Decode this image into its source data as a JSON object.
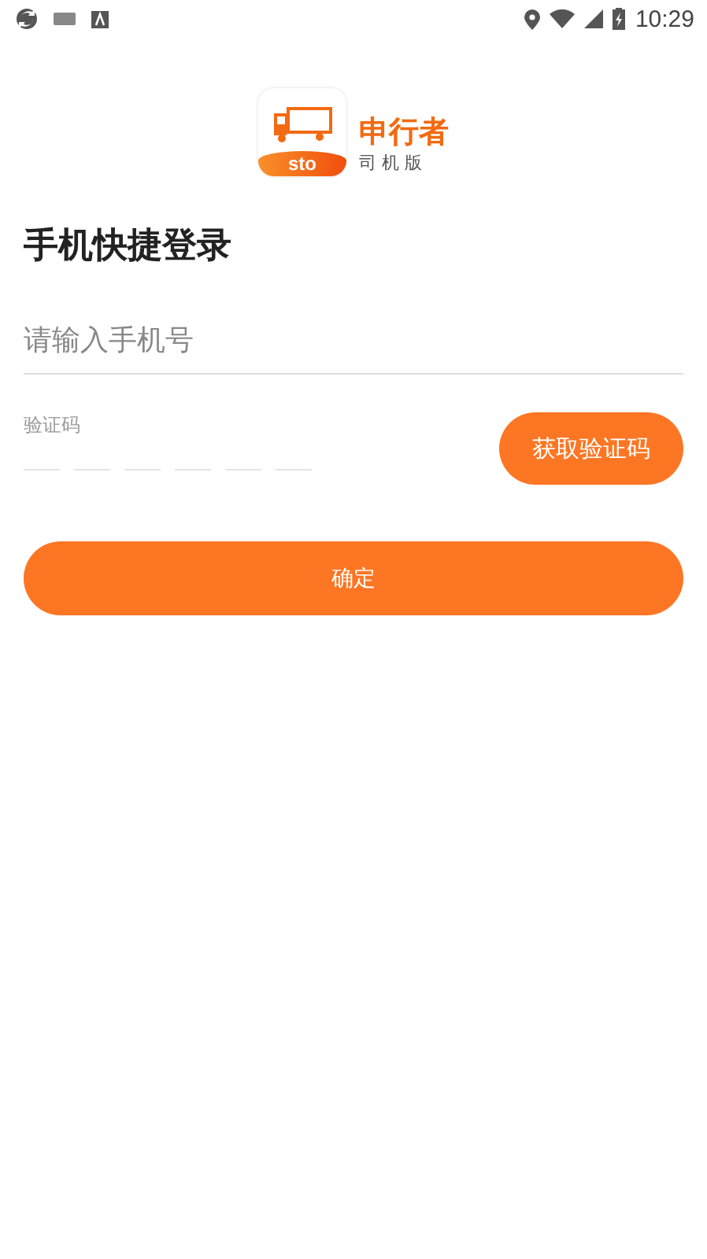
{
  "status_bar": {
    "time": "10:29"
  },
  "logo": {
    "badge": "sto",
    "name": "申行者",
    "subtitle": "司 机 版"
  },
  "title": "手机快捷登录",
  "phone_field": {
    "placeholder": "请输入手机号"
  },
  "code_field": {
    "label": "验证码"
  },
  "get_code_button": "获取验证码",
  "confirm_button": "确定"
}
